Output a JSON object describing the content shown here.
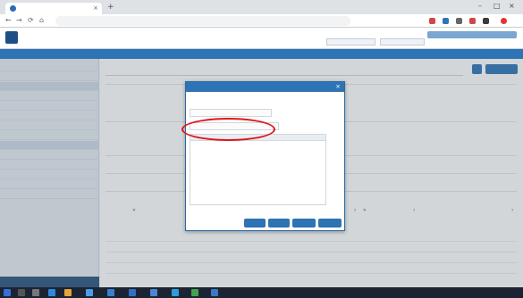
{
  "browser": {
    "tab_title": "",
    "url": "",
    "new_tab_glyph": "+",
    "tab_close_glyph": "×",
    "back_glyph": "←",
    "forward_glyph": "→",
    "reload_glyph": "⟳",
    "home_glyph": "⌂",
    "minimize_glyph": "–",
    "maximize_glyph": "□",
    "close_glyph": "×",
    "extension_colors": [
      "#d64545",
      "#2e73b3",
      "#666666",
      "#d64545",
      "#3a3a3a",
      "#e63333"
    ]
  },
  "app": {
    "logo_text": "",
    "user_label": "",
    "nav_items": [
      "",
      "",
      "",
      "",
      "",
      "",
      "",
      "",
      ""
    ],
    "page_title": "",
    "top_buttons": [
      "",
      ""
    ]
  },
  "sidebar": {
    "items": [
      {
        "label": "",
        "sub": false,
        "active": false
      },
      {
        "label": "",
        "sub": false,
        "active": false
      },
      {
        "label": "",
        "sub": false,
        "active": true
      },
      {
        "label": "",
        "sub": false,
        "active": false
      },
      {
        "label": "",
        "sub": false,
        "active": false
      },
      {
        "label": "",
        "sub": true,
        "active": false
      },
      {
        "label": "",
        "sub": true,
        "active": false
      },
      {
        "label": "",
        "sub": true,
        "active": false
      },
      {
        "label": "",
        "sub": true,
        "active": true
      },
      {
        "label": "",
        "sub": true,
        "active": false
      },
      {
        "label": "",
        "sub": true,
        "active": false
      },
      {
        "label": "",
        "sub": true,
        "active": false
      },
      {
        "label": "",
        "sub": true,
        "active": false
      },
      {
        "label": "",
        "sub": false,
        "active": false
      }
    ]
  },
  "main": {
    "fields": [
      {
        "label": "",
        "value": ""
      },
      {
        "label": "",
        "value": ""
      },
      {
        "label": "",
        "value": ""
      },
      {
        "label": "",
        "value": ""
      },
      {
        "label": "",
        "value": ""
      },
      {
        "label": "",
        "value": ""
      },
      {
        "label": "",
        "value": ""
      }
    ],
    "table_rows": [
      [
        "",
        "",
        "",
        ""
      ],
      [
        "",
        "",
        "",
        ""
      ],
      [
        "",
        "",
        "",
        ""
      ],
      [
        "",
        "",
        "",
        ""
      ]
    ]
  },
  "modal": {
    "title": "",
    "subtitle": "",
    "field1_placeholder": "",
    "field2_placeholder": "",
    "field3_placeholder": "",
    "list_header": "",
    "buttons": [
      "",
      "",
      "",
      ""
    ],
    "close_glyph": "×"
  },
  "taskbar": {
    "time": "",
    "date": ""
  },
  "colors": {
    "accent": "#2e73b3",
    "annotation": "#e0151b"
  }
}
